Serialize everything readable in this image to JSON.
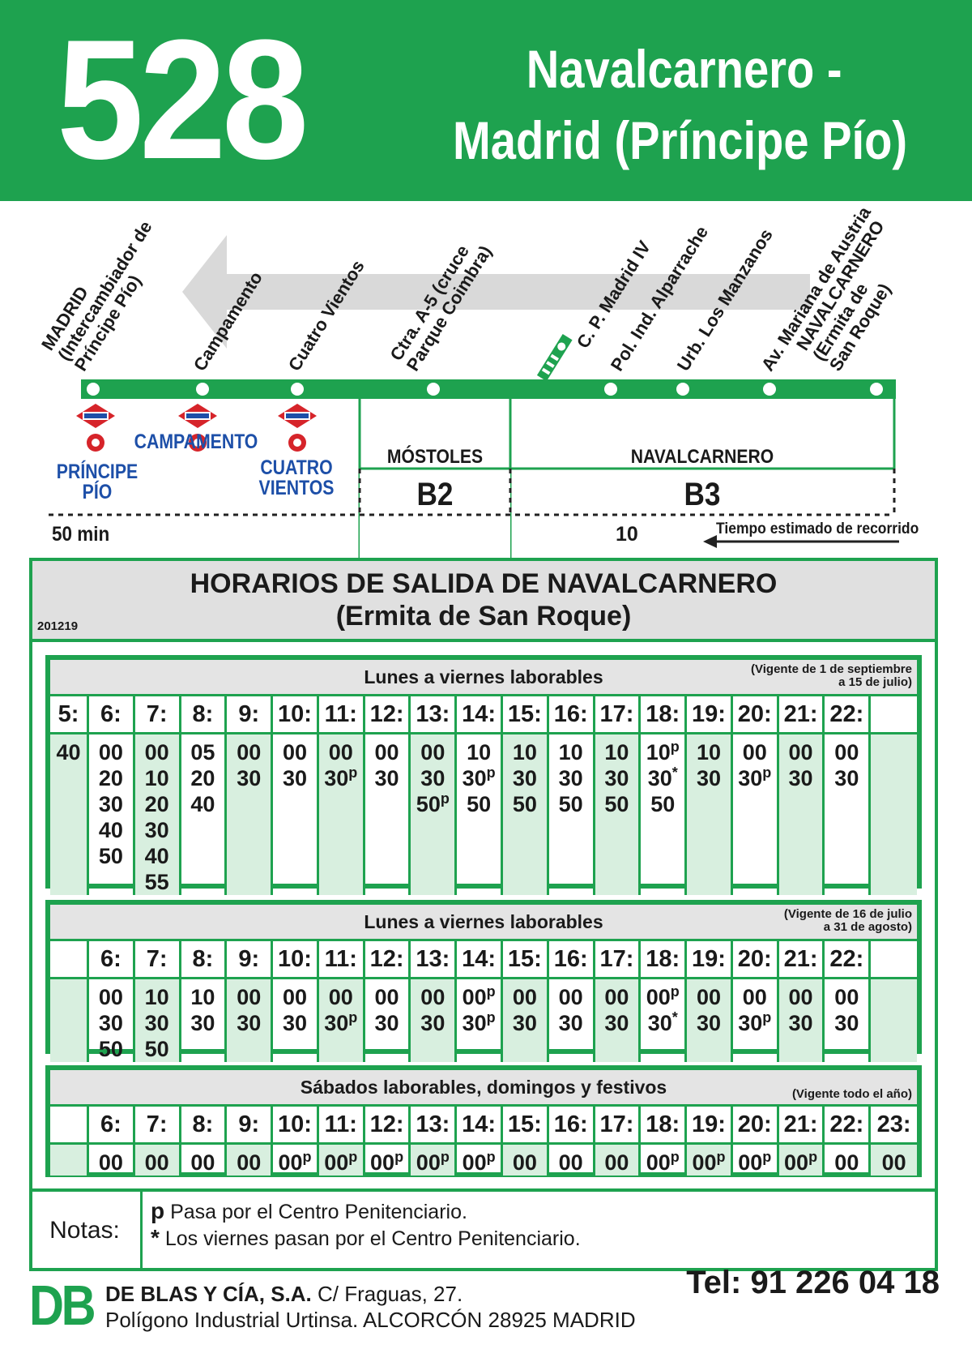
{
  "header": {
    "route_number": "528",
    "route_name_line1": "Navalcarnero -",
    "route_name_line2": "Madrid (Príncipe Pío)"
  },
  "route": {
    "stops": [
      "MADRID\n(Intercambiador de\nPríncipe Pío)",
      "Campamento",
      "Cuatro Vientos",
      "Ctra. A-5 (cruce\nParque Coimbra)",
      "C. P. Madrid IV",
      "Pol. Ind. Alparrache",
      "Urb. Los Manzanos",
      "Av. Mariana de Austria",
      "NAVALCARNERO\n(Ermita de\nSan Roque)"
    ],
    "metro_badge": "Metro",
    "metro_stations": [
      "PRÍNCIPE\nPÍO",
      "CAMPAMENTO",
      "CUATRO\nVIENTOS"
    ],
    "zones": [
      {
        "name": "MÓSTOLES",
        "code": "B2"
      },
      {
        "name": "NAVALCARNERO",
        "code": "B3"
      }
    ],
    "time_total": "50 min",
    "time_partial": "10",
    "time_caption": "Tiempo estimado de recorrido"
  },
  "timetable": {
    "title_line1": "HORARIOS DE SALIDA DE NAVALCARNERO",
    "title_line2": "(Ermita de San Roque)",
    "code": "201219",
    "blocks": [
      {
        "title": "Lunes a viernes laborables",
        "validity": "(Vigente de 1 de septiembre\na 15 de julio)",
        "hours": [
          "5:",
          "6:",
          "7:",
          "8:",
          "9:",
          "10:",
          "11:",
          "12:",
          "13:",
          "14:",
          "15:",
          "16:",
          "17:",
          "18:",
          "19:",
          "20:",
          "21:",
          "22:",
          ""
        ],
        "minutes": [
          [
            "40"
          ],
          [
            "00",
            "20",
            "30",
            "40",
            "50"
          ],
          [
            "00",
            "10",
            "20",
            "30",
            "40",
            "55"
          ],
          [
            "05",
            "20",
            "40"
          ],
          [
            "00",
            "30"
          ],
          [
            "00",
            "30"
          ],
          [
            "00",
            "30p"
          ],
          [
            "00",
            "30"
          ],
          [
            "00",
            "30",
            "50p"
          ],
          [
            "10",
            "30p",
            "50"
          ],
          [
            "10",
            "30",
            "50"
          ],
          [
            "10",
            "30",
            "50"
          ],
          [
            "10",
            "30",
            "50"
          ],
          [
            "10p",
            "30*",
            "50"
          ],
          [
            "10",
            "30"
          ],
          [
            "00",
            "30p"
          ],
          [
            "00",
            "30"
          ],
          [
            "00",
            "30"
          ],
          []
        ]
      },
      {
        "title": "Lunes a viernes laborables",
        "validity": "(Vigente de 16 de julio\na 31 de agosto)",
        "hours": [
          "",
          "6:",
          "7:",
          "8:",
          "9:",
          "10:",
          "11:",
          "12:",
          "13:",
          "14:",
          "15:",
          "16:",
          "17:",
          "18:",
          "19:",
          "20:",
          "21:",
          "22:",
          ""
        ],
        "minutes": [
          [],
          [
            "00",
            "30",
            "50"
          ],
          [
            "10",
            "30",
            "50"
          ],
          [
            "10",
            "30"
          ],
          [
            "00",
            "30"
          ],
          [
            "00",
            "30"
          ],
          [
            "00",
            "30p"
          ],
          [
            "00",
            "30"
          ],
          [
            "00",
            "30"
          ],
          [
            "00p",
            "30p"
          ],
          [
            "00",
            "30"
          ],
          [
            "00",
            "30"
          ],
          [
            "00",
            "30"
          ],
          [
            "00p",
            "30*"
          ],
          [
            "00",
            "30"
          ],
          [
            "00",
            "30p"
          ],
          [
            "00",
            "30"
          ],
          [
            "00",
            "30"
          ],
          []
        ]
      },
      {
        "title": "Sábados laborables, domingos y festivos",
        "validity": "(Vigente todo el año)",
        "hours": [
          "",
          "6:",
          "7:",
          "8:",
          "9:",
          "10:",
          "11:",
          "12:",
          "13:",
          "14:",
          "15:",
          "16:",
          "17:",
          "18:",
          "19:",
          "20:",
          "21:",
          "22:",
          "23:"
        ],
        "minutes": [
          [],
          [
            "00"
          ],
          [
            "00"
          ],
          [
            "00"
          ],
          [
            "00"
          ],
          [
            "00p"
          ],
          [
            "00p"
          ],
          [
            "00p"
          ],
          [
            "00p"
          ],
          [
            "00p"
          ],
          [
            "00"
          ],
          [
            "00"
          ],
          [
            "00"
          ],
          [
            "00p"
          ],
          [
            "00p"
          ],
          [
            "00p"
          ],
          [
            "00p"
          ],
          [
            "00"
          ],
          [
            "00"
          ]
        ]
      }
    ]
  },
  "notes": {
    "label": "Notas:",
    "items": [
      {
        "symbol": "p",
        "text": "Pasa por el Centro Penitenciario."
      },
      {
        "symbol": "*",
        "text": "Los viernes pasan por el Centro Penitenciario."
      }
    ]
  },
  "footer": {
    "logo": "DB",
    "company": "DE BLAS Y CÍA, S.A.",
    "address1": "C/ Fraguas, 27.",
    "address2": "Polígono Industrial Urtinsa. ALCORCÓN 28925 MADRID",
    "phone": "Tel: 91 226 04 18"
  },
  "colors": {
    "brand_green": "#1ea24f",
    "metro_red": "#d6242a",
    "metro_blue": "#1d4fa8",
    "shade": "#d8efdf"
  }
}
